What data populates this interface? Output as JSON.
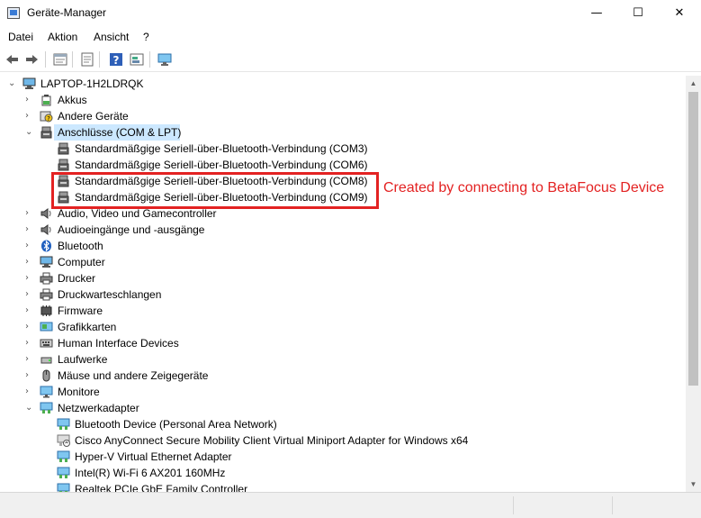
{
  "window": {
    "title": "Geräte-Manager",
    "min": "—",
    "max": "☐",
    "close": "✕"
  },
  "menu": [
    "Datei",
    "Aktion",
    "Ansicht",
    "?"
  ],
  "tree": {
    "root": "LAPTOP-1H2LDRQK",
    "akkus": "Akkus",
    "andere": "Andere Geräte",
    "anschluesse": "Anschlüsse (COM & LPT)",
    "com3": "Standardmäßgige Seriell-über-Bluetooth-Verbindung (COM3)",
    "com6": "Standardmäßgige Seriell-über-Bluetooth-Verbindung (COM6)",
    "com8": "Standardmäßgige Seriell-über-Bluetooth-Verbindung (COM8)",
    "com9": "Standardmäßgige Seriell-über-Bluetooth-Verbindung (COM9)",
    "audio_video": "Audio, Video und Gamecontroller",
    "audio_io": "Audioeingänge und -ausgänge",
    "bluetooth": "Bluetooth",
    "computer": "Computer",
    "drucker": "Drucker",
    "druckwarteschlangen": "Druckwarteschlangen",
    "firmware": "Firmware",
    "grafikkarten": "Grafikkarten",
    "hid": "Human Interface Devices",
    "laufwerke": "Laufwerke",
    "maeuse": "Mäuse und andere Zeigegeräte",
    "monitore": "Monitore",
    "netzwerkadapter": "Netzwerkadapter",
    "net_bt": "Bluetooth Device (Personal Area Network)",
    "net_cisco": "Cisco AnyConnect Secure Mobility Client Virtual Miniport Adapter for Windows x64",
    "net_hyperv": "Hyper-V Virtual Ethernet Adapter",
    "net_wifi": "Intel(R) Wi-Fi 6 AX201 160MHz",
    "net_realtek": "Realtek PCIe GbE Family Controller"
  },
  "annotation": "Created by connecting to BetaFocus Device",
  "colors": {
    "selection": "#cce8ff",
    "annotation": "#e32222",
    "icon_blue": "#2e75c6"
  },
  "icons": [
    "back-icon",
    "forward-icon",
    "properties-icon",
    "update-icon",
    "help-icon",
    "view-icon",
    "monitor-scan-icon"
  ]
}
